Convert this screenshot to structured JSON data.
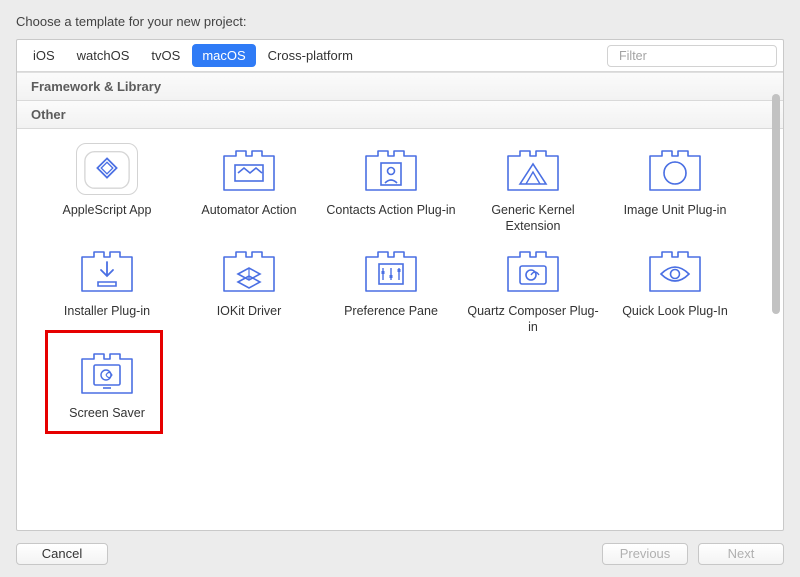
{
  "title": "Choose a template for your new project:",
  "tabs": [
    "iOS",
    "watchOS",
    "tvOS",
    "macOS",
    "Cross-platform"
  ],
  "selected_tab_index": 3,
  "filter_placeholder": "Filter",
  "sections": {
    "framework": "Framework & Library",
    "other": "Other"
  },
  "templates": [
    {
      "id": "applescript",
      "label": "AppleScript App"
    },
    {
      "id": "automator",
      "label": "Automator Action"
    },
    {
      "id": "contacts",
      "label": "Contacts Action Plug-in"
    },
    {
      "id": "kernel",
      "label": "Generic Kernel Extension"
    },
    {
      "id": "imageunit",
      "label": "Image Unit Plug-in"
    },
    {
      "id": "installer",
      "label": "Installer Plug-in"
    },
    {
      "id": "iokit",
      "label": "IOKit Driver"
    },
    {
      "id": "prefpane",
      "label": "Preference Pane"
    },
    {
      "id": "quartz",
      "label": "Quartz Composer Plug-in"
    },
    {
      "id": "quicklook",
      "label": "Quick Look Plug-In"
    },
    {
      "id": "screensaver",
      "label": "Screen Saver"
    }
  ],
  "highlighted_template": "screensaver",
  "buttons": {
    "cancel": "Cancel",
    "previous": "Previous",
    "next": "Next"
  },
  "colors": {
    "accent": "#2f7bf6",
    "highlight": "#e60000",
    "icon_stroke": "#4a6fe3"
  }
}
